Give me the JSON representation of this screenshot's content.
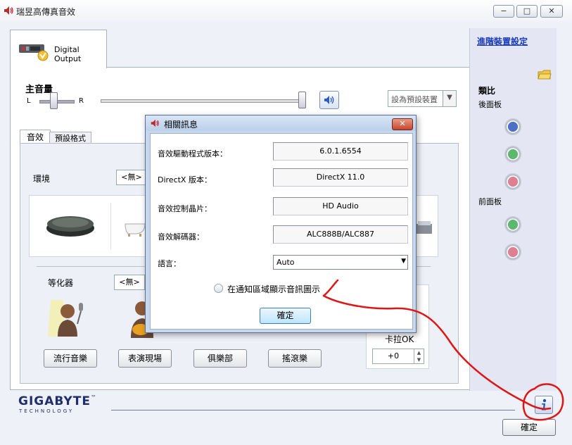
{
  "window": {
    "title": "瑞昱高傳真音效",
    "min_glyph": "−",
    "max_glyph": "□",
    "close_glyph": "✕"
  },
  "device_tab": {
    "label": "Digital Output"
  },
  "master_volume": {
    "label": "主音量",
    "left": "L",
    "right": "R",
    "balance": 0.4,
    "level": 1.0
  },
  "default_device": {
    "label": "設為預設裝置",
    "arrow": "▼"
  },
  "tabs": [
    {
      "label": "音效"
    },
    {
      "label": "預設格式"
    }
  ],
  "environment": {
    "label": "環境",
    "value": "<無>"
  },
  "equalizer": {
    "label": "等化器",
    "value": "<無>",
    "presets": [
      "流行音樂",
      "表演現場",
      "俱樂部",
      "搖滾樂"
    ]
  },
  "karaoke": {
    "label": "卡拉OK",
    "value": "+0",
    "up": "▲",
    "down": "▼"
  },
  "right_panel": {
    "advanced_link": "進階裝置設定",
    "analog_label": "類比",
    "rear_label": "後面板",
    "front_label": "前面板"
  },
  "colors": {
    "jack_blue": "#4f70c8",
    "jack_green": "#5cb86c",
    "jack_pink": "#e07e92",
    "annotation_red": "#e01515",
    "brand_blue": "#1e2e6e"
  },
  "brand": {
    "name": "GIGABYTE",
    "tagline": "TECHNOLOGY",
    "tm": "™"
  },
  "main_ok": "確定",
  "dialog": {
    "title": "相關訊息",
    "close_glyph": "✕",
    "rows": [
      {
        "label": "音效驅動程式版本：",
        "value": "6.0.1.6554"
      },
      {
        "label": "DirectX 版本：",
        "value": "DirectX 11.0"
      },
      {
        "label": "音效控制晶片：",
        "value": "HD Audio"
      },
      {
        "label": "音效解碼器：",
        "value": "ALC888B/ALC887"
      }
    ],
    "language_label": "語言：",
    "language_value": "Auto",
    "language_arrow": "▼",
    "notify_label": "在通知區域顯示音訊圖示",
    "ok_label": "確定"
  }
}
